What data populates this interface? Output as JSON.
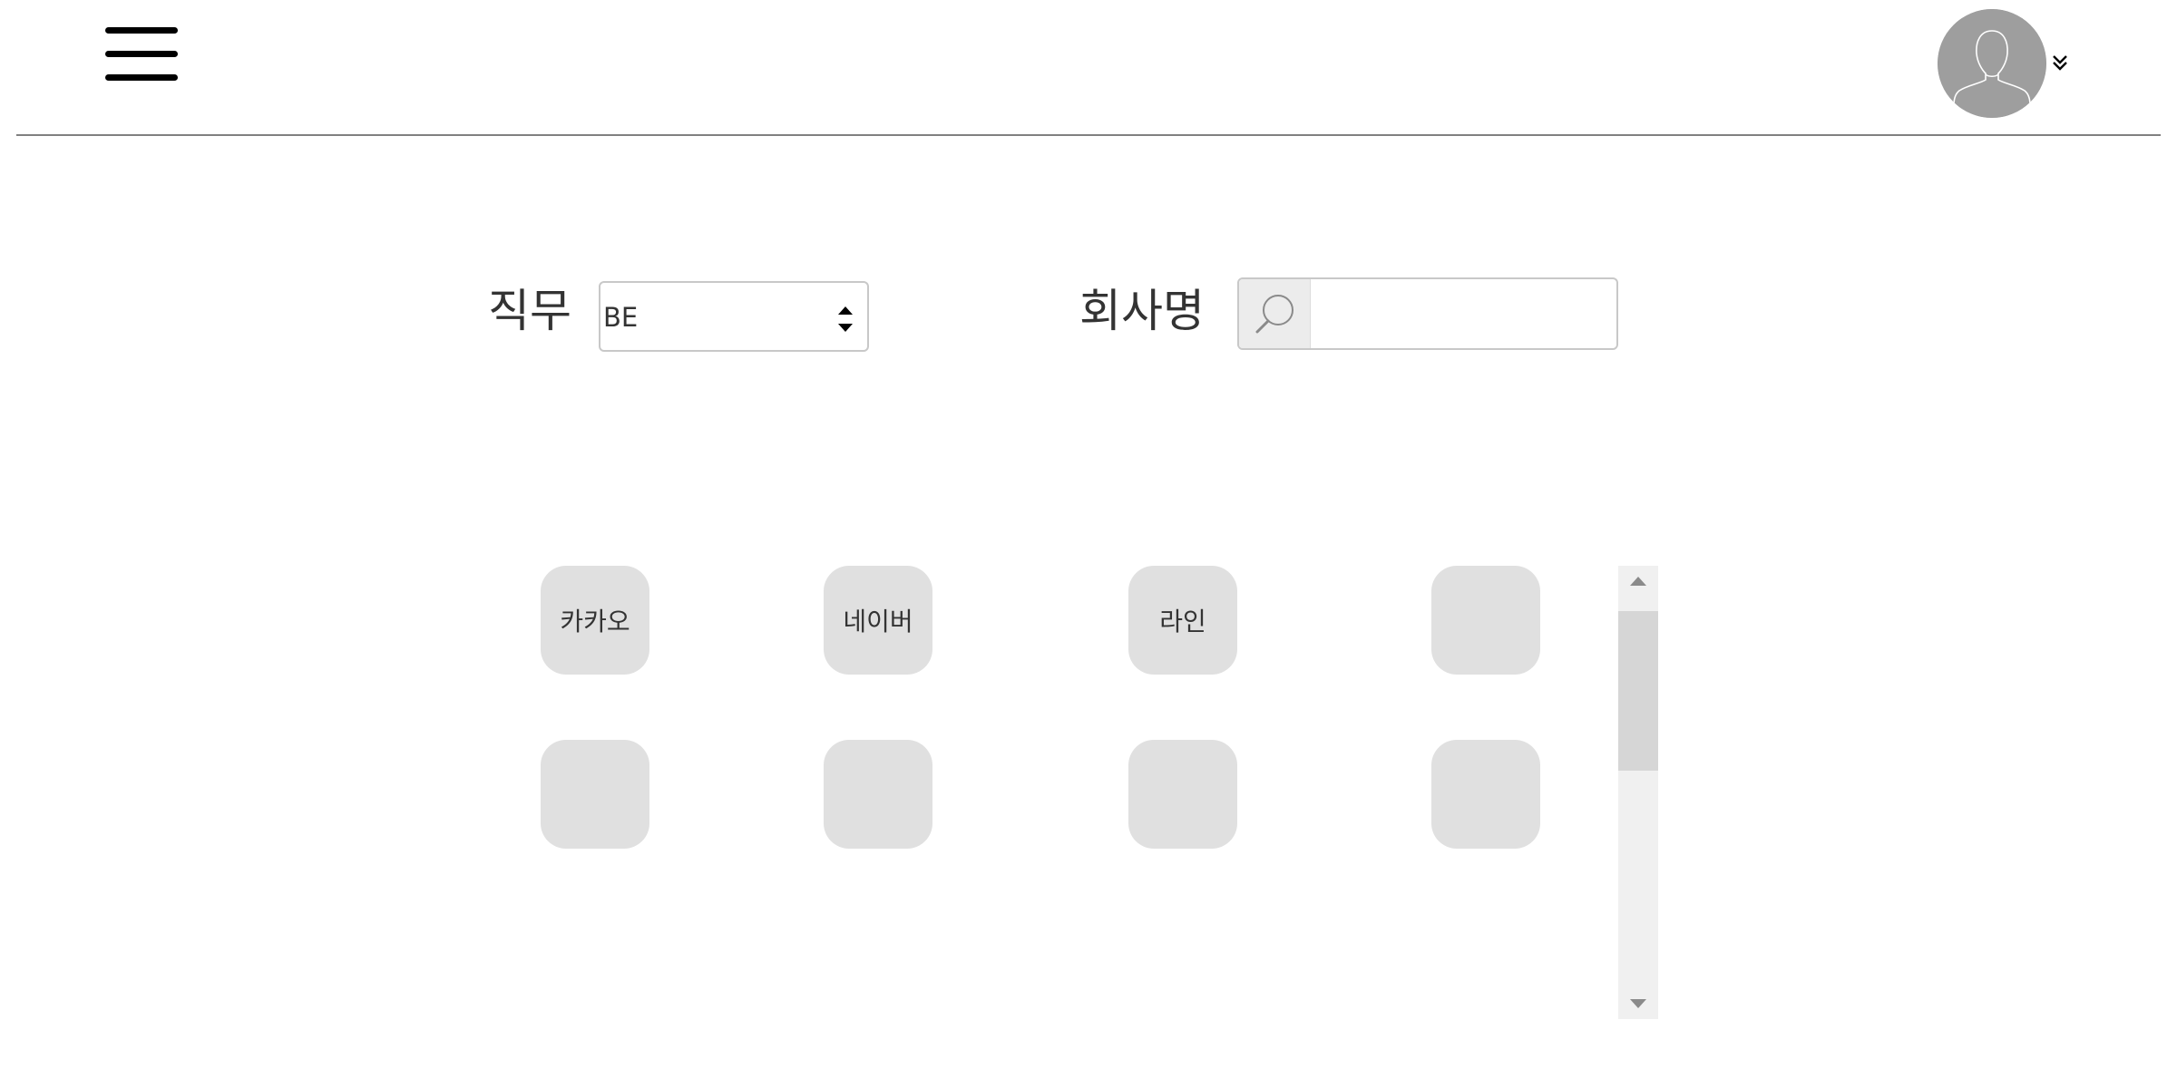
{
  "header": {
    "menu_icon": "hamburger-menu-icon",
    "avatar_icon": "user-avatar-icon",
    "dropdown_icon": "double-chevron-down-icon"
  },
  "filters": {
    "job_label": "직무",
    "job_selected": "BE",
    "company_label": "회사명",
    "search_icon": "search-icon",
    "search_value": ""
  },
  "companies": [
    {
      "label": "카카오"
    },
    {
      "label": "네이버"
    },
    {
      "label": "라인"
    },
    {
      "label": ""
    },
    {
      "label": ""
    },
    {
      "label": ""
    },
    {
      "label": ""
    },
    {
      "label": ""
    }
  ],
  "colors": {
    "tile_bg": "#e0e0e0",
    "avatar_bg": "#9e9e9e",
    "divider": "#808080",
    "scroll_track": "#f0f0f0",
    "scroll_thumb": "#d6d6d6"
  }
}
